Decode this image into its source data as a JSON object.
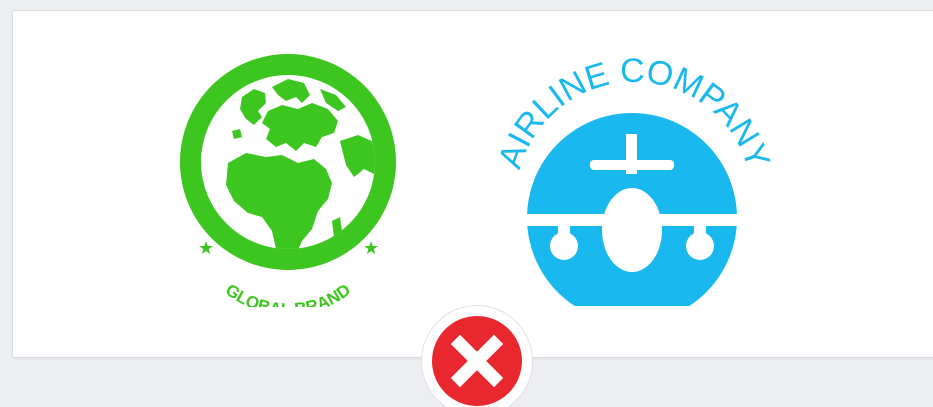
{
  "logos": {
    "global": {
      "text": "GLOBAL BRAND",
      "color": "#3dc61f",
      "icon": "globe-icon"
    },
    "airline": {
      "text": "AIRLINE COMPANY",
      "color": "#19b8ef",
      "icon": "airplane-icon"
    }
  },
  "status": {
    "icon": "close-icon",
    "color": "#e8282e"
  }
}
